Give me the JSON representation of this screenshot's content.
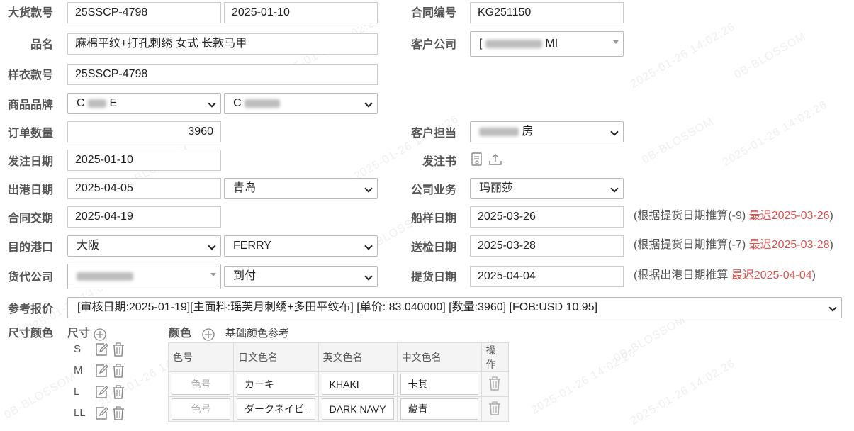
{
  "watermark": {
    "text1": "2025-01-26 14:02:26",
    "text2": "0B-BLOSSOM"
  },
  "labels": {
    "bulk_no": "大货款号",
    "product_name": "品名",
    "sample_no": "样衣款号",
    "brand": "商品品牌",
    "order_qty": "订单数量",
    "order_date": "发注日期",
    "ship_date": "出港日期",
    "contract_due": "合同交期",
    "dest_port": "目的港口",
    "forwarder": "货代公司",
    "ref_price": "参考报价",
    "size_color": "尺寸颜色",
    "contract_no": "合同编号",
    "customer_company": "客户公司",
    "customer_rep": "客户担当",
    "order_doc": "发注书",
    "company_business": "公司业务",
    "ship_sample_date": "船样日期",
    "inspection_date": "送检日期",
    "pickup_date": "提货日期"
  },
  "fields": {
    "bulk_no": "25SSCP-4798",
    "bulk_date": "2025-01-10",
    "product_name": "麻棉平纹+打孔刺绣 女式 长款马甲",
    "sample_no": "25SSCP-4798",
    "brand1": "C",
    "brand1_tail": "E",
    "brand2": "C",
    "order_qty": "3960",
    "order_date": "2025-01-10",
    "ship_date": "2025-04-05",
    "ship_port": "青岛",
    "contract_due": "2025-04-19",
    "dest_port": "大阪",
    "dest_method": "FERRY",
    "forwarder_payment": "到付",
    "ref_price": "[审核日期:2025-01-19][主面料:瑶芙月刺绣+多田平纹布] [单价: 83.040000] [数量:3960] [FOB:USD 10.95]",
    "contract_no": "KG251150",
    "customer_company_prefix": "[",
    "customer_company_suffix": "MI",
    "customer_rep_suffix": "房",
    "company_business": "玛丽莎",
    "ship_sample_date": "2025-03-26",
    "inspection_date": "2025-03-28",
    "pickup_date": "2025-04-04"
  },
  "hints": {
    "ship_sample": {
      "text": "(根据提货日期推算(-9) ",
      "late": "最迟2025-03-26",
      "close": ")"
    },
    "inspection": {
      "text": "(根据提货日期推算(-7) ",
      "late": "最迟2025-03-28",
      "close": ")"
    },
    "pickup": {
      "text": "(根据出港日期推算 ",
      "late": "最迟2025-04-04",
      "close": ")"
    }
  },
  "sizes": {
    "header": "尺寸",
    "items": [
      {
        "label": "S"
      },
      {
        "label": "M"
      },
      {
        "label": "L"
      },
      {
        "label": "LL"
      }
    ]
  },
  "colors": {
    "header": "颜色",
    "reference_link": "基础颜色参考",
    "columns": [
      "色号",
      "日文色名",
      "英文色名",
      "中文色名",
      "操作"
    ],
    "rows": [
      {
        "code_placeholder": "色号",
        "jp": "カーキ",
        "en": "KHAKI",
        "cn": "卡其"
      },
      {
        "code_placeholder": "色号",
        "jp": "ダークネイビ-",
        "en": "DARK NAVY",
        "cn": "藏青"
      }
    ]
  },
  "accent_color": "#d9534f",
  "icons": [
    "add-icon",
    "edit-icon",
    "trash-icon",
    "document-icon",
    "upload-icon",
    "chevron-down-icon"
  ]
}
